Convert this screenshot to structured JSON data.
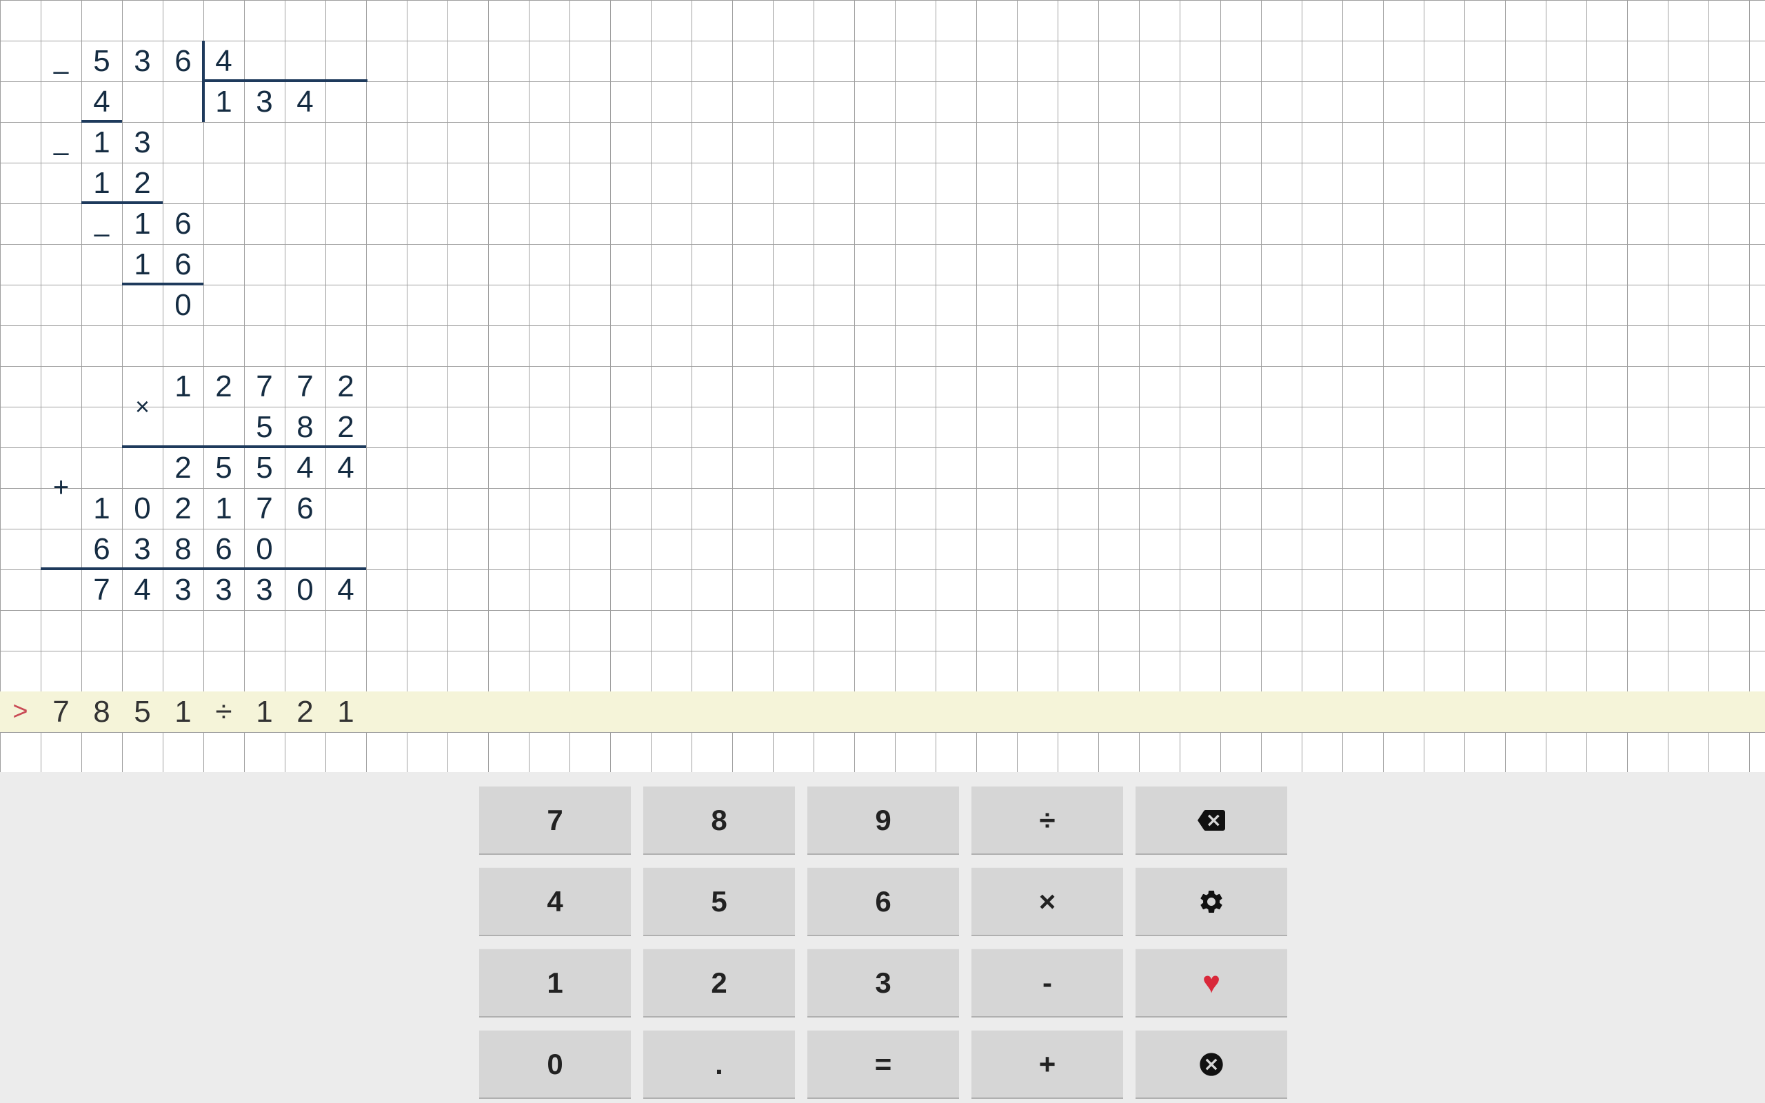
{
  "division": {
    "dividend": [
      "5",
      "3",
      "6"
    ],
    "divisor": [
      "4"
    ],
    "quotient": [
      "1",
      "3",
      "4"
    ],
    "step1_minus": "–",
    "step1_sub": [
      "4"
    ],
    "step2_rem": [
      "1",
      "3"
    ],
    "step2_minus": "–",
    "step2_sub": [
      "1",
      "2"
    ],
    "step3_rem": [
      "1",
      "6"
    ],
    "step3_minus": "–",
    "step3_sub": [
      "1",
      "6"
    ],
    "final_rem": [
      "0"
    ]
  },
  "multiplication": {
    "times": "×",
    "plus": "+",
    "multiplicand": [
      "1",
      "2",
      "7",
      "7",
      "2"
    ],
    "multiplier": [
      "5",
      "8",
      "2"
    ],
    "partial1": [
      "2",
      "5",
      "5",
      "4",
      "4"
    ],
    "partial2": [
      "1",
      "0",
      "2",
      "1",
      "7",
      "6"
    ],
    "partial3": [
      "6",
      "3",
      "8",
      "6",
      "0"
    ],
    "product": [
      "7",
      "4",
      "3",
      "3",
      "3",
      "0",
      "4"
    ]
  },
  "input": {
    "prompt": ">",
    "expression": [
      "7",
      "8",
      "5",
      "1",
      "÷",
      "1",
      "2",
      "1"
    ]
  },
  "keypad": {
    "r0": [
      "7",
      "8",
      "9",
      "÷"
    ],
    "r1": [
      "4",
      "5",
      "6",
      "×"
    ],
    "r2": [
      "1",
      "2",
      "3",
      "-"
    ],
    "r3": [
      "0",
      ".",
      "=",
      "+"
    ]
  }
}
